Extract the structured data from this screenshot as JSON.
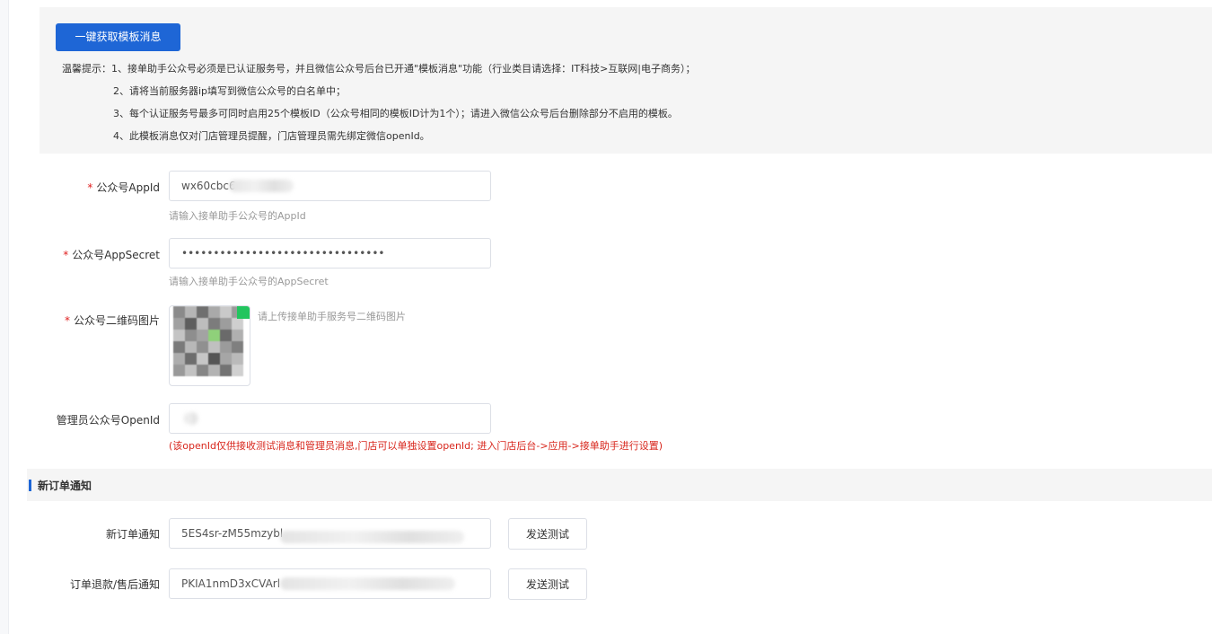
{
  "notice": {
    "fetch_button": "一键获取模板消息",
    "tips": [
      "温馨提示：1、接单助手公众号必须是已认证服务号，并且微信公众号后台已开通\"模板消息\"功能（行业类目请选择：IT科技>互联网|电子商务）；",
      "2、请将当前服务器ip填写到微信公众号的白名单中；",
      "3、每个认证服务号最多可同时启用25个模板ID（公众号相同的模板ID计为1个）；请进入微信公众号后台删除部分不启用的模板。",
      "4、此模板消息仅对门店管理员提醒，门店管理员需先绑定微信openId。"
    ]
  },
  "form": {
    "appid": {
      "label": "公众号AppId",
      "required_mark": "*",
      "value": "wx60cbc6",
      "hint": "请输入接单助手公众号的AppId"
    },
    "appsecret": {
      "label": "公众号AppSecret",
      "required_mark": "*",
      "value": "••••••••••••••••••••••••••••••••",
      "hint": "请输入接单助手公众号的AppSecret"
    },
    "qrcode": {
      "label": "公众号二维码图片",
      "required_mark": "*",
      "hint": "请上传接单助手服务号二维码图片"
    },
    "openid": {
      "label": "管理员公众号OpenId",
      "value": "",
      "warning": "(该openId仅供接收测试消息和管理员消息,门店可以单独设置openId; 进入门店后台->应用->接单助手进行设置)"
    }
  },
  "section": {
    "title": "新订单通知",
    "rows": [
      {
        "label": "新订单通知",
        "value": "5ES4sr-zM55mzybl",
        "button": "发送测试"
      },
      {
        "label": "订单退款/售后通知",
        "value": "PKIA1nmD3xCVArl",
        "button": "发送测试"
      }
    ]
  },
  "colors": {
    "primary": "#1e66d6",
    "required": "#e02020",
    "warning": "#d8261c",
    "hint": "#999999",
    "panel_bg": "#f5f5f5"
  }
}
